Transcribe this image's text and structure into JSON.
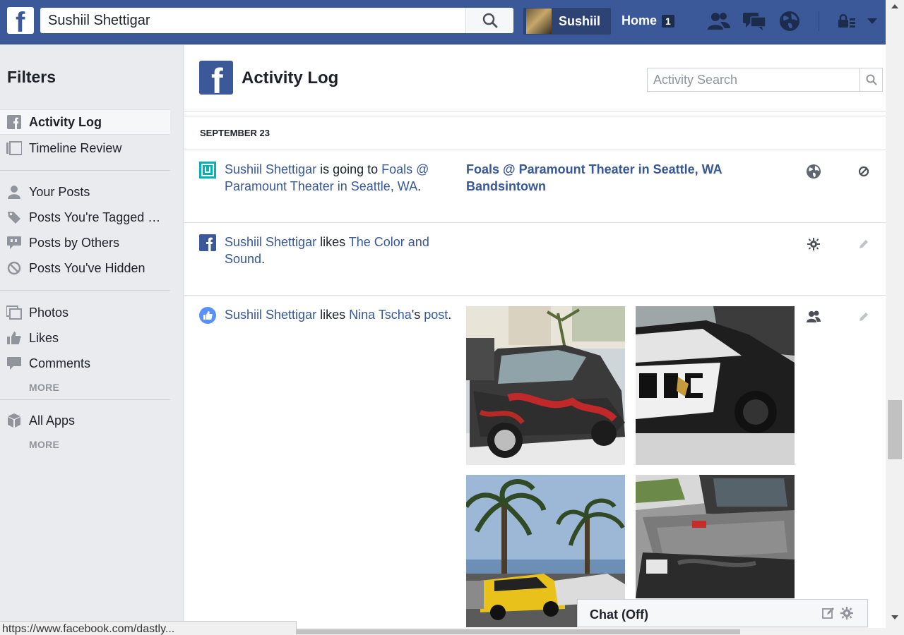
{
  "topbar": {
    "logo_letter": "f",
    "search_value": "Sushiil Shettigar",
    "profile_name": "Sushiil",
    "home_label": "Home",
    "home_count": "1"
  },
  "sidebar": {
    "title": "Filters",
    "items": [
      {
        "label": "Activity Log",
        "icon": "facebook-square-icon"
      },
      {
        "label": "Timeline Review",
        "icon": "timeline-icon"
      },
      {
        "label": "Your Posts",
        "icon": "person-icon"
      },
      {
        "label": "Posts You're Tagged …",
        "icon": "tag-icon"
      },
      {
        "label": "Posts by Others",
        "icon": "speech-icon"
      },
      {
        "label": "Posts You've Hidden",
        "icon": "hidden-icon"
      },
      {
        "label": "Photos",
        "icon": "photos-icon"
      },
      {
        "label": "Likes",
        "icon": "thumbs-up-icon"
      },
      {
        "label": "Comments",
        "icon": "comment-icon"
      },
      {
        "label": "All Apps",
        "icon": "cube-icon"
      }
    ],
    "more1": "MORE",
    "more2": "MORE"
  },
  "main": {
    "title": "Activity Log",
    "search_placeholder": "Activity Search",
    "date_header": "SEPTEMBER 23",
    "entries": [
      {
        "actor": "Sushiil Shettigar",
        "verb": " is going to ",
        "object": "Foals @ Paramount Theater in Seattle, WA",
        "end": ".",
        "detail_line1": "Foals @ Paramount Theater in Seattle, WA",
        "detail_line2": "Bandsintown"
      },
      {
        "actor": "Sushiil Shettigar",
        "verb": " likes ",
        "object": "The Color and Sound",
        "end": "."
      },
      {
        "actor": "Sushiil Shettigar",
        "verb": " likes ",
        "object": "Nina Tscha",
        "mid": "'s ",
        "object2": "post",
        "end": "."
      }
    ]
  },
  "chat": {
    "label": "Chat (Off)"
  },
  "statusbar": {
    "url": "https://www.facebook.com/dastly..."
  },
  "colors": {
    "brand": "#3b5998",
    "link": "#365899"
  }
}
